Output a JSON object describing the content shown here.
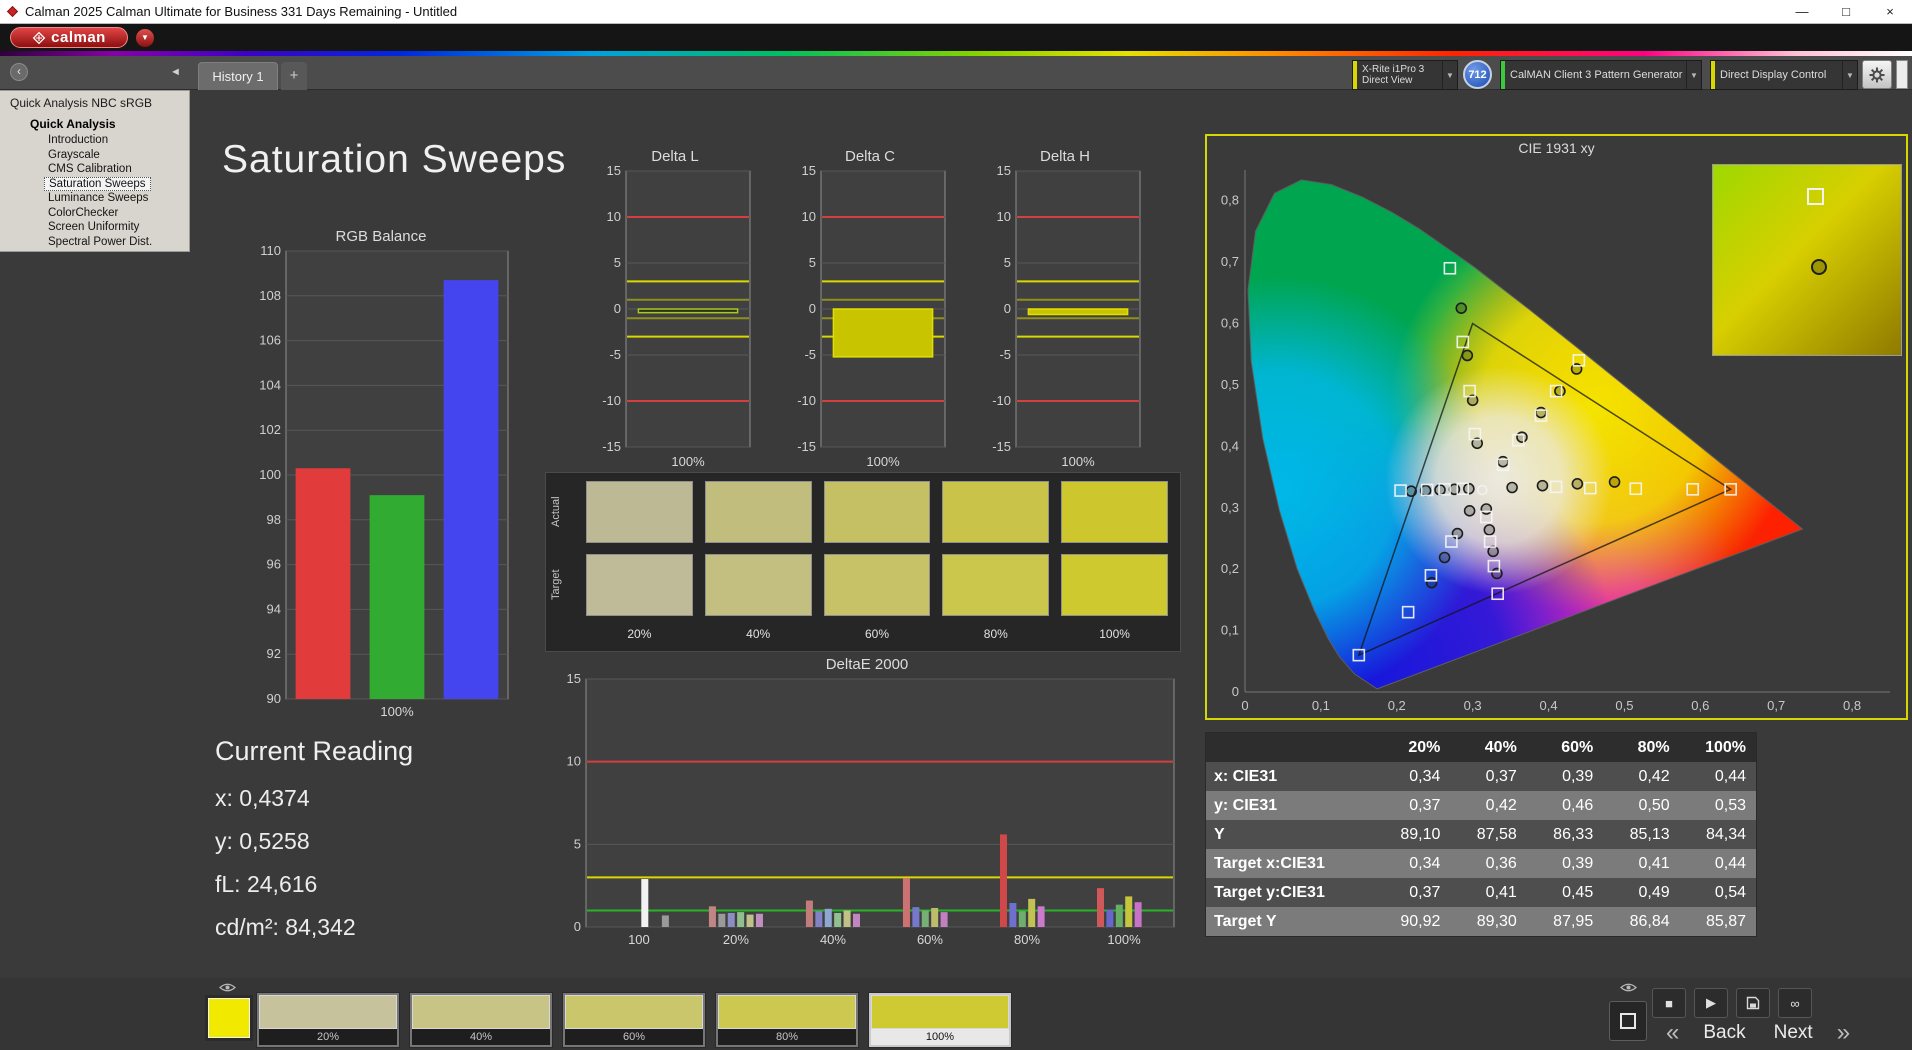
{
  "window": {
    "title": "Calman 2025 Calman Ultimate for Business 331 Days Remaining  - Untitled"
  },
  "icons": {
    "minimize": "—",
    "maximize": "□",
    "close": "×",
    "dropdown_arrow": "▼",
    "panel_menu": "‹",
    "collapse_left": "◄",
    "add_tab": "+",
    "stop": "■",
    "play": "▶",
    "loop": "∞",
    "back_chevrons": "«",
    "next_chevrons": "»"
  },
  "brand": {
    "logo_text": "calman"
  },
  "toolbar": {
    "history_tab": "History 1",
    "meter_dropdown": {
      "line1": "X-Rite i1Pro 3",
      "line2": "Direct View"
    },
    "meter_badge": "712",
    "source_dropdown": "CalMAN Client 3 Pattern Generator",
    "display_dropdown": "Direct Display Control"
  },
  "sidebar": {
    "header": "Quick Analysis NBC sRGB",
    "root": "Quick Analysis",
    "items": [
      {
        "label": "Introduction",
        "selected": false
      },
      {
        "label": "Grayscale",
        "selected": false
      },
      {
        "label": "CMS Calibration",
        "selected": false
      },
      {
        "label": "Saturation Sweeps",
        "selected": true
      },
      {
        "label": "Luminance Sweeps",
        "selected": false
      },
      {
        "label": "ColorChecker",
        "selected": false
      },
      {
        "label": "Screen Uniformity",
        "selected": false
      },
      {
        "label": "Spectral Power Dist.",
        "selected": false
      }
    ]
  },
  "page": {
    "title": "Saturation Sweeps"
  },
  "current_reading": {
    "title": "Current Reading",
    "lines": [
      {
        "label": "x:",
        "value": "0,4374"
      },
      {
        "label": "y:",
        "value": "0,5258"
      },
      {
        "label": "fL:",
        "value": "24,616"
      },
      {
        "label": "cd/m²:",
        "value": "84,342"
      }
    ]
  },
  "swatch_panel": {
    "row_labels": [
      "Actual",
      "Target"
    ],
    "column_labels": [
      "20%",
      "40%",
      "60%",
      "80%",
      "100%"
    ],
    "actual_colors": [
      "#bdb995",
      "#c1bd7d",
      "#c5c064",
      "#c9c449",
      "#cdc72d"
    ],
    "target_colors": [
      "#bfbb98",
      "#c3bf80",
      "#c7c267",
      "#cbc64c",
      "#cfc930"
    ]
  },
  "results_table": {
    "columns": [
      "20%",
      "40%",
      "60%",
      "80%",
      "100%"
    ],
    "rows": [
      {
        "label": "x: CIE31",
        "values": [
          "0,34",
          "0,37",
          "0,39",
          "0,42",
          "0,44"
        ]
      },
      {
        "label": "y: CIE31",
        "values": [
          "0,37",
          "0,42",
          "0,46",
          "0,50",
          "0,53"
        ]
      },
      {
        "label": "Y",
        "values": [
          "89,10",
          "87,58",
          "86,33",
          "85,13",
          "84,34"
        ]
      },
      {
        "label": "Target x:CIE31",
        "values": [
          "0,34",
          "0,36",
          "0,39",
          "0,41",
          "0,44"
        ]
      },
      {
        "label": "Target y:CIE31",
        "values": [
          "0,37",
          "0,41",
          "0,45",
          "0,49",
          "0,54"
        ]
      },
      {
        "label": "Target Y",
        "values": [
          "90,92",
          "89,30",
          "87,95",
          "86,84",
          "85,87"
        ]
      }
    ]
  },
  "bottom_bar": {
    "current_swatch_color": "#f2e900",
    "swatches": [
      {
        "label": "20%",
        "color": "#c6c29c",
        "selected": false
      },
      {
        "label": "40%",
        "color": "#c8c485",
        "selected": false
      },
      {
        "label": "60%",
        "color": "#cac66b",
        "selected": false
      },
      {
        "label": "80%",
        "color": "#cdc84f",
        "selected": false
      },
      {
        "label": "100%",
        "color": "#d0ca32",
        "selected": true
      }
    ],
    "back_label": "Back",
    "next_label": "Next"
  },
  "chart_data": [
    {
      "id": "rgb_balance",
      "type": "bar",
      "title": "RGB Balance",
      "categories": [
        "Red",
        "Green",
        "Blue"
      ],
      "values": [
        100.3,
        99.1,
        108.7
      ],
      "colors": [
        "#e23b3b",
        "#32ab32",
        "#4545ef"
      ],
      "ylim": [
        90,
        110
      ],
      "ytick_step": 2,
      "xlabel": "100%"
    },
    {
      "id": "delta_l",
      "type": "bar",
      "title": "Delta L",
      "categories": [
        "100%"
      ],
      "values": [
        -0.4
      ],
      "colors": [
        "#2e331c"
      ],
      "bar_stroke": "#a8c81e",
      "ylim": [
        -15,
        15
      ],
      "ytick_step": 5,
      "xlabel": "100%",
      "ref_lines": [
        {
          "y": 10,
          "color": "#d24040"
        },
        {
          "y": -10,
          "color": "#d24040"
        },
        {
          "y": 3,
          "color": "#d8d800"
        },
        {
          "y": -3,
          "color": "#d8d800"
        },
        {
          "y": 1,
          "color": "#8f8f1f"
        },
        {
          "y": -1,
          "color": "#8f8f1f"
        }
      ]
    },
    {
      "id": "delta_c",
      "type": "bar",
      "title": "Delta C",
      "categories": [
        "100%"
      ],
      "values": [
        -5.2
      ],
      "colors": [
        "#c9c400"
      ],
      "bar_stroke": "#e2de00",
      "ylim": [
        -15,
        15
      ],
      "ytick_step": 5,
      "xlabel": "100%",
      "ref_lines": [
        {
          "y": 10,
          "color": "#d24040"
        },
        {
          "y": -10,
          "color": "#d24040"
        },
        {
          "y": 3,
          "color": "#d8d800"
        },
        {
          "y": -3,
          "color": "#d8d800"
        },
        {
          "y": 1,
          "color": "#8f8f1f"
        },
        {
          "y": -1,
          "color": "#8f8f1f"
        }
      ]
    },
    {
      "id": "delta_h",
      "type": "bar",
      "title": "Delta H",
      "categories": [
        "100%"
      ],
      "values": [
        -0.6
      ],
      "colors": [
        "#c9c400"
      ],
      "bar_stroke": "#e2de00",
      "ylim": [
        -15,
        15
      ],
      "ytick_step": 5,
      "xlabel": "100%",
      "ref_lines": [
        {
          "y": 10,
          "color": "#d24040"
        },
        {
          "y": -10,
          "color": "#d24040"
        },
        {
          "y": 3,
          "color": "#d8d800"
        },
        {
          "y": -3,
          "color": "#d8d800"
        },
        {
          "y": 1,
          "color": "#8f8f1f"
        },
        {
          "y": -1,
          "color": "#8f8f1f"
        }
      ]
    },
    {
      "id": "deltae2000",
      "type": "bar",
      "title": "DeltaE 2000",
      "ylim": [
        0,
        15
      ],
      "yticks": [
        0,
        5,
        10,
        15
      ],
      "ref_lines": [
        {
          "y": 10,
          "color": "#d24040"
        },
        {
          "y": 3,
          "color": "#d8d800"
        },
        {
          "y": 1,
          "color": "#27b427"
        }
      ],
      "x_ticks": [
        {
          "pos": 0.09,
          "label": "100"
        },
        {
          "pos": 0.255,
          "label": "20%"
        },
        {
          "pos": 0.42,
          "label": "40%"
        },
        {
          "pos": 0.585,
          "label": "60%"
        },
        {
          "pos": 0.75,
          "label": "80%"
        },
        {
          "pos": 0.915,
          "label": "100%"
        }
      ],
      "bars": [
        {
          "pos": 0.1,
          "value": 2.9,
          "color": "#f2f2f2"
        },
        {
          "pos": 0.135,
          "value": 0.7,
          "color": "#9a9a9a"
        },
        {
          "pos": 0.215,
          "value": 1.25,
          "color": "#c28585"
        },
        {
          "pos": 0.231,
          "value": 0.8,
          "color": "#9a9a9a"
        },
        {
          "pos": 0.247,
          "value": 0.85,
          "color": "#8d8dc6"
        },
        {
          "pos": 0.263,
          "value": 0.9,
          "color": "#8fbf8f"
        },
        {
          "pos": 0.279,
          "value": 0.75,
          "color": "#c0c08a"
        },
        {
          "pos": 0.295,
          "value": 0.8,
          "color": "#c08fc0"
        },
        {
          "pos": 0.38,
          "value": 1.6,
          "color": "#c27c7c"
        },
        {
          "pos": 0.396,
          "value": 0.95,
          "color": "#8282c8"
        },
        {
          "pos": 0.412,
          "value": 1.1,
          "color": "#8fa8d2"
        },
        {
          "pos": 0.428,
          "value": 0.85,
          "color": "#8fc28f"
        },
        {
          "pos": 0.444,
          "value": 1.0,
          "color": "#c2c285"
        },
        {
          "pos": 0.46,
          "value": 0.8,
          "color": "#c285c2"
        },
        {
          "pos": 0.545,
          "value": 2.95,
          "color": "#cc7272"
        },
        {
          "pos": 0.561,
          "value": 1.2,
          "color": "#7777cc"
        },
        {
          "pos": 0.577,
          "value": 1.0,
          "color": "#77b077"
        },
        {
          "pos": 0.593,
          "value": 1.15,
          "color": "#bcbc6a"
        },
        {
          "pos": 0.609,
          "value": 0.9,
          "color": "#c27fc2"
        },
        {
          "pos": 0.71,
          "value": 5.6,
          "color": "#d04848"
        },
        {
          "pos": 0.726,
          "value": 1.45,
          "color": "#6f6fd0"
        },
        {
          "pos": 0.742,
          "value": 0.95,
          "color": "#6fae6f"
        },
        {
          "pos": 0.758,
          "value": 1.7,
          "color": "#c2c254"
        },
        {
          "pos": 0.774,
          "value": 1.25,
          "color": "#cc7acc"
        },
        {
          "pos": 0.875,
          "value": 2.35,
          "color": "#d05858"
        },
        {
          "pos": 0.891,
          "value": 1.05,
          "color": "#6666cc"
        },
        {
          "pos": 0.907,
          "value": 1.35,
          "color": "#66ae66"
        },
        {
          "pos": 0.923,
          "value": 1.85,
          "color": "#c6c63e"
        },
        {
          "pos": 0.939,
          "value": 1.5,
          "color": "#c873c8"
        }
      ]
    },
    {
      "id": "cie1931",
      "type": "scatter",
      "title": "CIE 1931 xy",
      "xlim": [
        0,
        0.85
      ],
      "ylim": [
        0,
        0.85
      ],
      "x_ticks": [
        "0",
        "0,1",
        "0,2",
        "0,3",
        "0,4",
        "0,5",
        "0,6",
        "0,7",
        "0,8"
      ],
      "y_ticks": [
        "0",
        "0,1",
        "0,2",
        "0,3",
        "0,4",
        "0,5",
        "0,6",
        "0,7",
        "0,8"
      ],
      "gamut_triangle": [
        [
          0.64,
          0.33
        ],
        [
          0.3,
          0.6
        ],
        [
          0.15,
          0.06
        ]
      ],
      "white_point": [
        0.3127,
        0.329
      ],
      "series": [
        {
          "name": "measured",
          "marker": "circle",
          "points": [
            [
              0.34,
              0.375
            ],
            [
              0.365,
              0.415
            ],
            [
              0.39,
              0.455
            ],
            [
              0.415,
              0.49
            ],
            [
              0.437,
              0.526
            ],
            [
              0.295,
              0.331
            ],
            [
              0.276,
              0.33
            ],
            [
              0.257,
              0.329
            ],
            [
              0.238,
              0.328
            ],
            [
              0.219,
              0.327
            ],
            [
              0.352,
              0.333
            ],
            [
              0.392,
              0.336
            ],
            [
              0.438,
              0.339
            ],
            [
              0.487,
              0.342
            ],
            [
              0.306,
              0.405
            ],
            [
              0.3,
              0.475
            ],
            [
              0.293,
              0.548
            ],
            [
              0.285,
              0.625
            ],
            [
              0.296,
              0.295
            ],
            [
              0.28,
              0.258
            ],
            [
              0.263,
              0.219
            ],
            [
              0.246,
              0.178
            ],
            [
              0.318,
              0.298
            ],
            [
              0.322,
              0.264
            ],
            [
              0.327,
              0.229
            ],
            [
              0.332,
              0.193
            ]
          ]
        },
        {
          "name": "target",
          "marker": "square",
          "points": [
            [
              0.34,
              0.37
            ],
            [
              0.36,
              0.41
            ],
            [
              0.39,
              0.45
            ],
            [
              0.41,
              0.49
            ],
            [
              0.44,
              0.54
            ],
            [
              0.41,
              0.334
            ],
            [
              0.455,
              0.332
            ],
            [
              0.515,
              0.331
            ],
            [
              0.59,
              0.33
            ],
            [
              0.64,
              0.33
            ],
            [
              0.303,
              0.42
            ],
            [
              0.296,
              0.49
            ],
            [
              0.287,
              0.57
            ],
            [
              0.27,
              0.69
            ],
            [
              0.272,
              0.245
            ],
            [
              0.245,
              0.19
            ],
            [
              0.215,
              0.13
            ],
            [
              0.15,
              0.06
            ],
            [
              0.318,
              0.285
            ],
            [
              0.323,
              0.245
            ],
            [
              0.328,
              0.205
            ],
            [
              0.333,
              0.16
            ],
            [
              0.287,
              0.331
            ],
            [
              0.263,
              0.33
            ],
            [
              0.24,
              0.329
            ],
            [
              0.205,
              0.328
            ]
          ]
        }
      ]
    }
  ]
}
